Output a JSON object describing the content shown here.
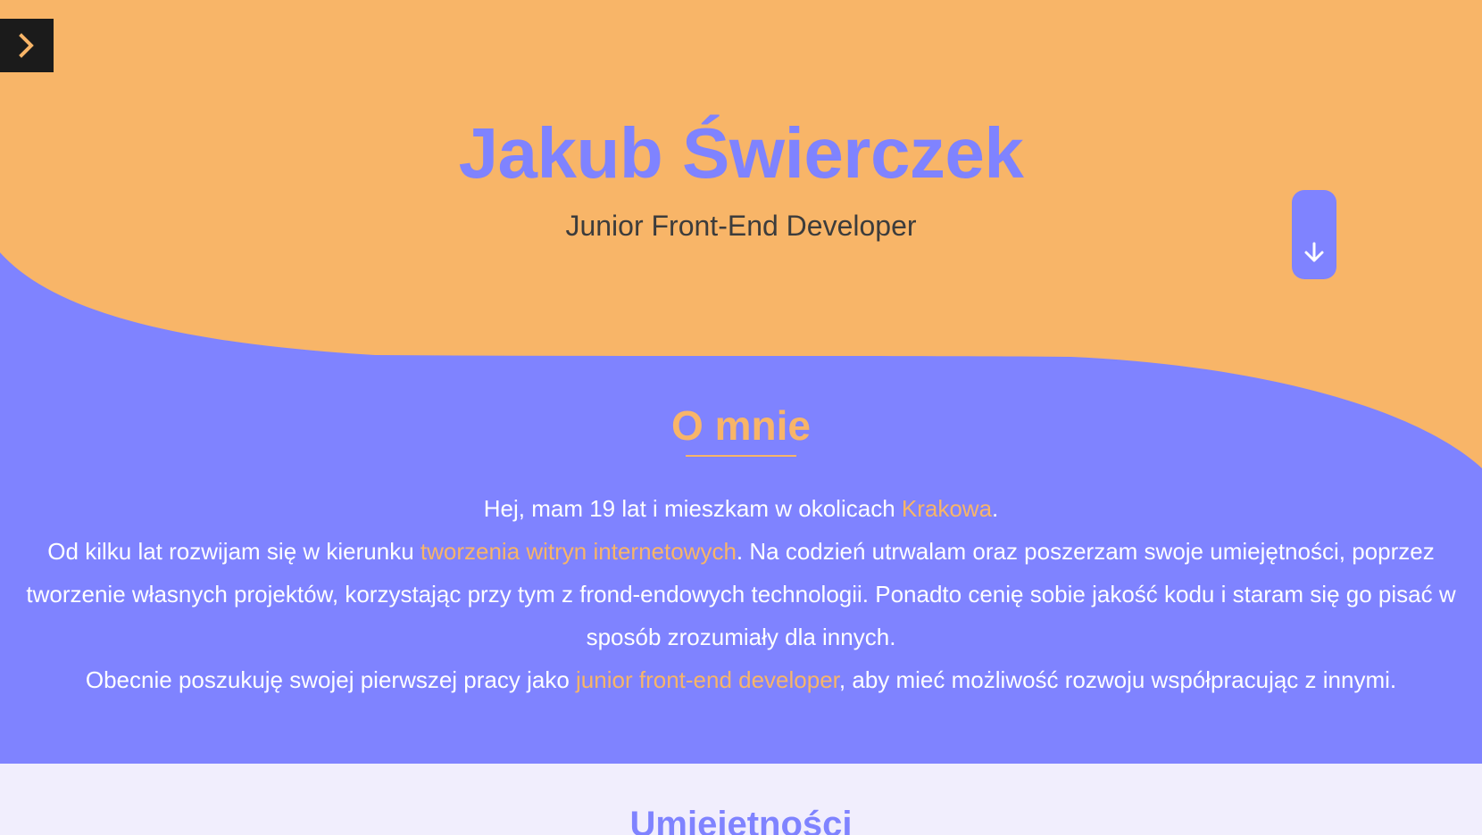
{
  "colors": {
    "accent_orange": "#f8b568",
    "accent_purple": "#7f83ff",
    "dark": "#1b1b1b",
    "light_bg": "#f1eefd"
  },
  "nav": {
    "menu_toggle_icon": "chevron-right-icon"
  },
  "hero": {
    "title": "Jakub Świerczek",
    "subtitle": "Junior Front-End Developer",
    "scroll_icon": "arrow-down-icon"
  },
  "about": {
    "heading": "O mnie",
    "line1": {
      "before": "Hej, mam 19 lat i mieszkam w okolicach ",
      "highlight": "Krakowa",
      "after": "."
    },
    "line2": {
      "before": "Od kilku lat rozwijam się w kierunku ",
      "highlight": "tworzenia witryn internetowych",
      "after": ". Na codzień utrwalam oraz poszerzam swoje umiejętności, poprzez tworzenie własnych projektów, korzystając przy tym z frond-endowych technologii. Ponadto cenię sobie jakość kodu i staram się go pisać w sposób zrozumiały dla innych."
    },
    "line3": {
      "before": "Obecnie poszukuję swojej pierwszej pracy jako ",
      "highlight": "junior front-end developer",
      "after": ", aby mieć możliwość rozwoju współpracując z innymi."
    }
  },
  "skills": {
    "heading": "Umiejętności"
  }
}
